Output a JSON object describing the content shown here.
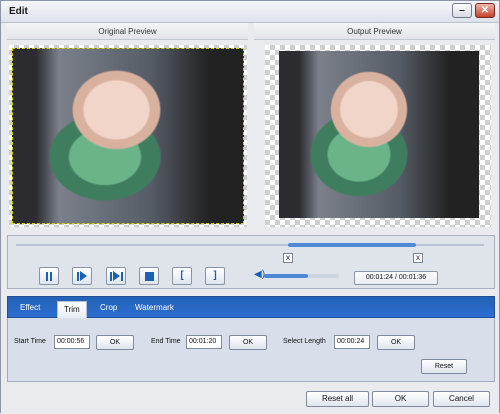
{
  "window": {
    "title": "Edit",
    "minimize_label": "–",
    "close_label": "✕"
  },
  "preview": {
    "original_label": "Original Preview",
    "output_label": "Output Preview"
  },
  "player": {
    "time_display": "00:01:24 / 00:01:36",
    "marker_left": "x",
    "marker_right": "x"
  },
  "tabs": [
    {
      "label": "Effect"
    },
    {
      "label": "Trim"
    },
    {
      "label": "Crop"
    },
    {
      "label": "Watermark"
    }
  ],
  "trim": {
    "start_label": "Start Time",
    "start_value": "00:00:56",
    "start_ok": "OK",
    "end_label": "End Time",
    "end_value": "00:01:20",
    "end_ok": "OK",
    "length_label": "Select Length",
    "length_value": "00:00:24",
    "length_ok": "OK",
    "reset_label": "Reset"
  },
  "footer": {
    "reset_all": "Reset all",
    "ok": "OK",
    "cancel": "Cancel"
  },
  "colors": {
    "tab_bar": "#2d6fd1",
    "trim_range": "#4f8ad8"
  }
}
